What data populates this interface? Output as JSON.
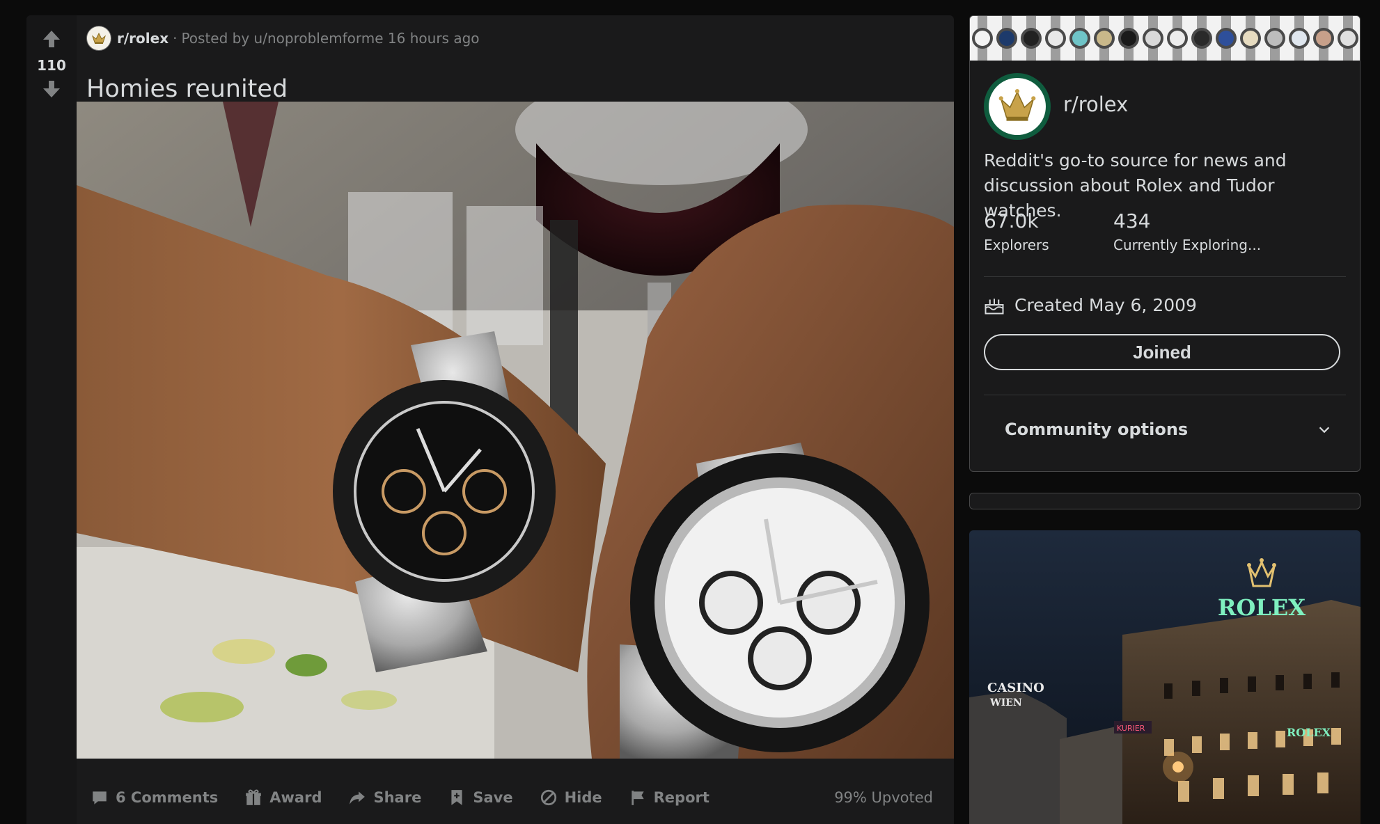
{
  "post": {
    "vote_count": "110",
    "subreddit": "r/rolex",
    "separator": "·",
    "posted_by": "Posted by u/noproblemforme",
    "time_ago": "16 hours ago",
    "title": "Homies reunited",
    "actions": {
      "comments": "6 Comments",
      "award": "Award",
      "share": "Share",
      "save": "Save",
      "hide": "Hide",
      "report": "Report"
    },
    "upvoted": "99% Upvoted"
  },
  "sidebar": {
    "community_name": "r/rolex",
    "description": "Reddit's go-to source for news and discussion about Rolex and Tudor watches.",
    "stats": [
      {
        "value": "67.0k",
        "label": "Explorers"
      },
      {
        "value": "434",
        "label": "Currently Exploring..."
      }
    ],
    "created": "Created May 6, 2009",
    "join_button": "Joined",
    "community_options": "Community options"
  },
  "promo": {
    "brand": "ROLEX",
    "sign_casino_line1": "CASINO",
    "sign_casino_line2": "WIEN",
    "sign_kurier": "KURIER",
    "brand_small": "ROLEX"
  },
  "colors": {
    "background": "#0b0b0b",
    "card": "#1a1a1b",
    "text": "#d7dadc",
    "muted": "#818384",
    "rolex_green": "#0f5c3e",
    "rolex_neon": "#7ff0c0"
  }
}
